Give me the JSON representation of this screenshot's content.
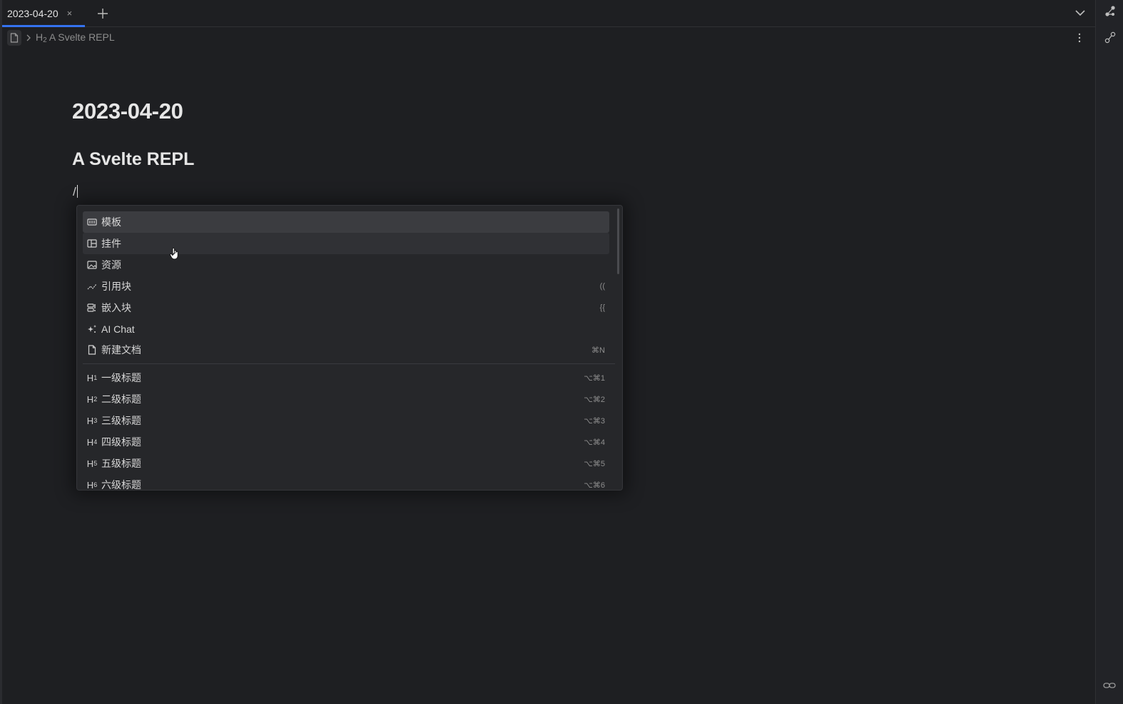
{
  "tabs": [
    {
      "label": "2023-04-20",
      "active": true
    }
  ],
  "tab_close": "×",
  "breadcrumb": {
    "heading_prefix": "H",
    "heading_level": "2",
    "heading_text": "A Svelte REPL"
  },
  "document": {
    "title": "2023-04-20",
    "heading": "A Svelte REPL",
    "input_text": "/"
  },
  "hint_menu": {
    "items": [
      {
        "icon": "template-icon",
        "label": "模板",
        "shortcut": ""
      },
      {
        "icon": "widget-icon",
        "label": "挂件",
        "shortcut": ""
      },
      {
        "icon": "image-icon",
        "label": "资源",
        "shortcut": ""
      },
      {
        "icon": "ref-block-icon",
        "label": "引用块",
        "shortcut": "(("
      },
      {
        "icon": "embed-block-icon",
        "label": "嵌入块",
        "shortcut": "{{"
      },
      {
        "icon": "sparkle-icon",
        "label": "AI Chat",
        "shortcut": ""
      },
      {
        "icon": "new-doc-icon",
        "label": "新建文档",
        "shortcut": "⌘N"
      }
    ],
    "headings": [
      {
        "icon_text": "H",
        "level": "1",
        "label": "一级标题",
        "shortcut": "⌥⌘1"
      },
      {
        "icon_text": "H",
        "level": "2",
        "label": "二级标题",
        "shortcut": "⌥⌘2"
      },
      {
        "icon_text": "H",
        "level": "3",
        "label": "三级标题",
        "shortcut": "⌥⌘3"
      },
      {
        "icon_text": "H",
        "level": "4",
        "label": "四级标题",
        "shortcut": "⌥⌘4"
      },
      {
        "icon_text": "H",
        "level": "5",
        "label": "五级标题",
        "shortcut": "⌥⌘5"
      },
      {
        "icon_text": "H",
        "level": "6",
        "label": "六级标题",
        "shortcut": "⌥⌘6"
      }
    ]
  },
  "colors": {
    "background": "#1e1f22",
    "accent": "#3573f0",
    "menu_bg": "#26272a",
    "selected_item": "#3b3c40"
  }
}
